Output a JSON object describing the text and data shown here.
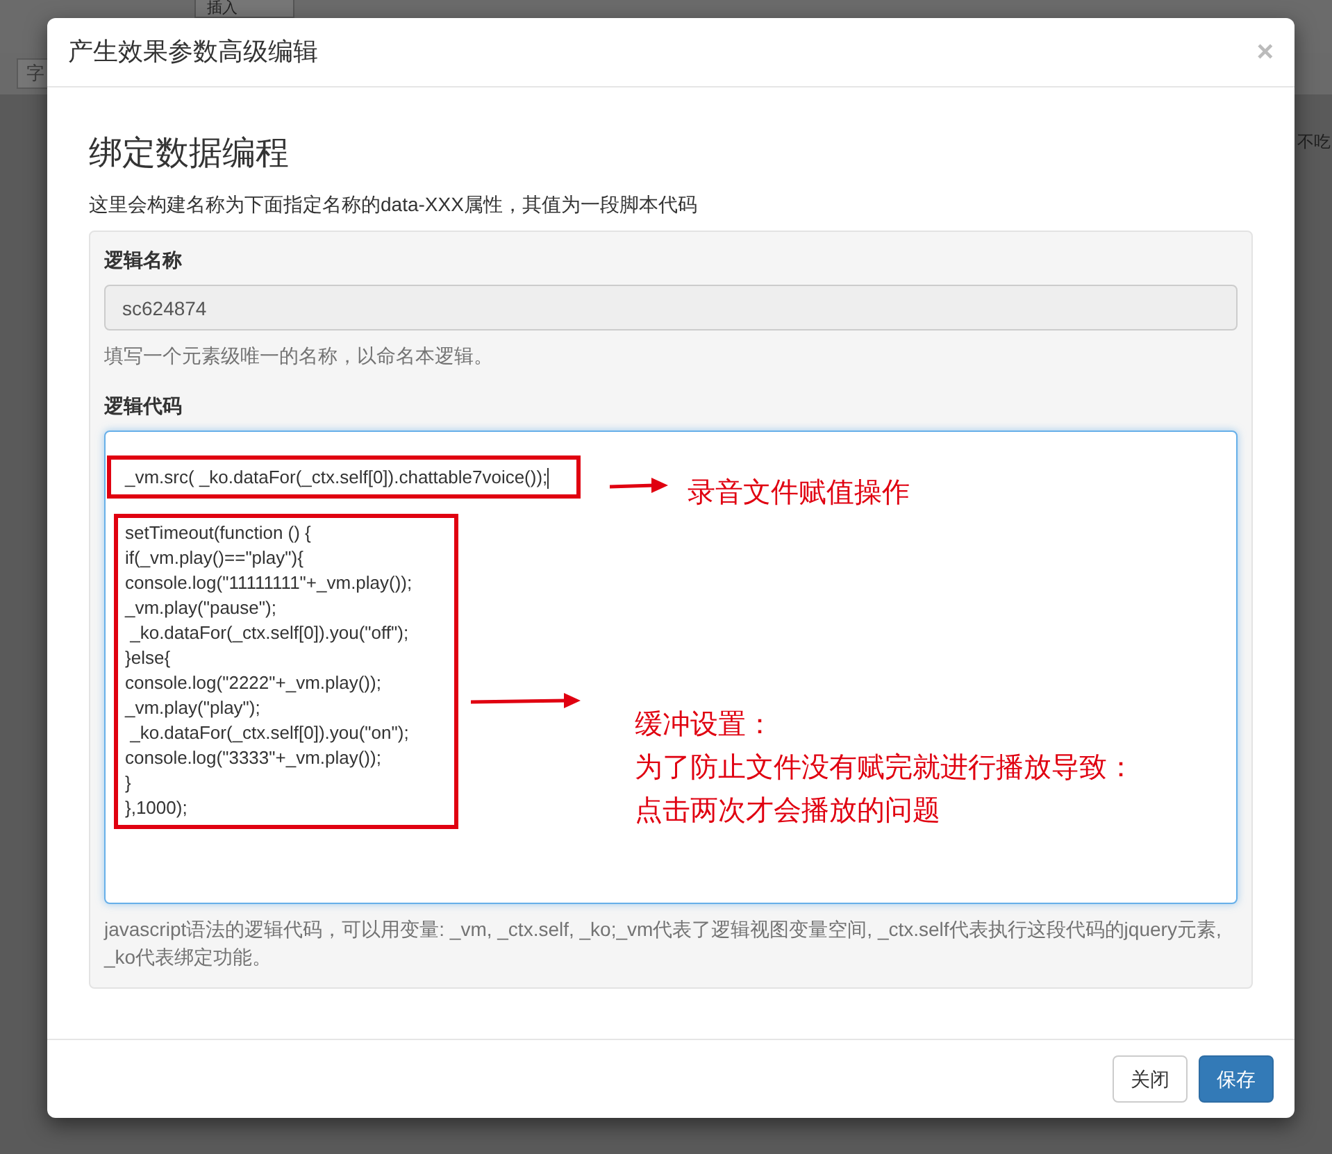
{
  "background": {
    "menu_label": "插入",
    "font_label": "字",
    "side_text": "不吃"
  },
  "modal": {
    "title": "产生效果参数高级编辑",
    "close": "×"
  },
  "heading": "绑定数据编程",
  "description": "这里会构建名称为下面指定名称的data-XXX属性，其值为一段脚本代码",
  "name_field": {
    "label": "逻辑名称",
    "value": "sc624874",
    "disabled": true,
    "help": "填写一个元素级唯一的名称，以命名本逻辑。"
  },
  "code_field": {
    "label": "逻辑代码",
    "focused": true,
    "first_line": "_vm.src( _ko.dataFor(_ctx.self[0]).chattable7voice());",
    "block_lines": [
      "setTimeout(function () {",
      "if(_vm.play()==\"play\"){",
      "console.log(\"11111111\"+_vm.play());",
      "_vm.play(\"pause\");",
      " _ko.dataFor(_ctx.self[0]).you(\"off\");",
      "}else{",
      "console.log(\"2222\"+_vm.play());",
      "_vm.play(\"play\");",
      " _ko.dataFor(_ctx.self[0]).you(\"on\");",
      "console.log(\"3333\"+_vm.play());",
      "}",
      "},1000);"
    ],
    "help": "javascript语法的逻辑代码，可以用变量: _vm, _ctx.self, _ko;_vm代表了逻辑视图变量空间, _ctx.self代表执行这段代码的jquery元素, _ko代表绑定功能。"
  },
  "annotations": [
    {
      "lines": [
        "录音文件赋值操作"
      ]
    },
    {
      "lines": [
        "缓冲设置：",
        "为了防止文件没有赋完就进行播放导致：",
        "点击两次才会播放的问题"
      ]
    }
  ],
  "buttons": [
    {
      "label": "关闭",
      "kind": "default"
    },
    {
      "label": "保存",
      "kind": "primary"
    }
  ]
}
